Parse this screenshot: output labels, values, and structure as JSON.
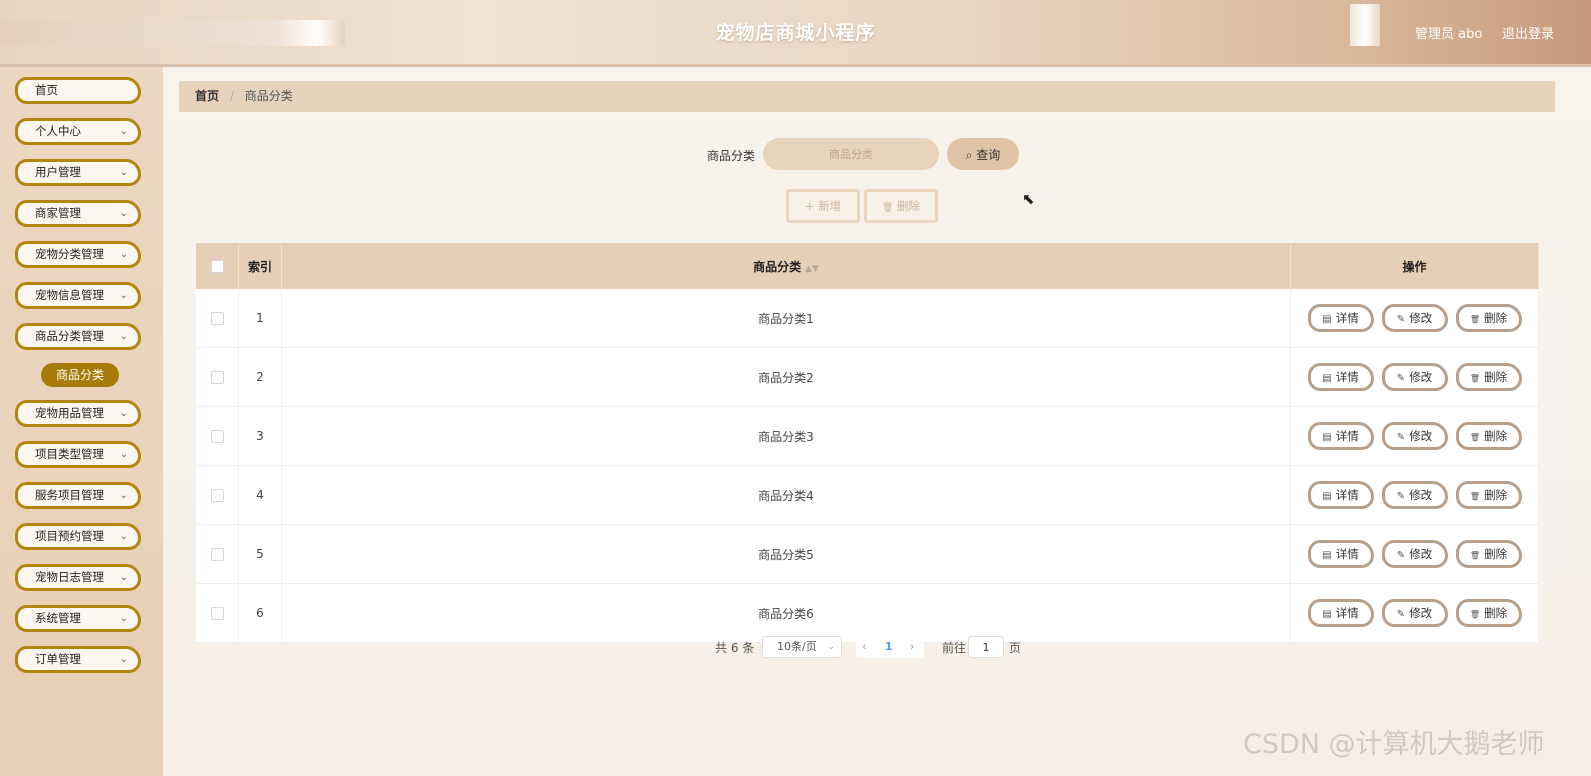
{
  "header": {
    "title": "宠物店商城小程序",
    "user_label": "管理员 abo",
    "logout_label": "退出登录"
  },
  "sidebar": {
    "items": [
      {
        "label": "首页",
        "has_arrow": false
      },
      {
        "label": "个人中心",
        "has_arrow": true
      },
      {
        "label": "用户管理",
        "has_arrow": true
      },
      {
        "label": "商家管理",
        "has_arrow": true
      },
      {
        "label": "宠物分类管理",
        "has_arrow": true
      },
      {
        "label": "宠物信息管理",
        "has_arrow": true
      },
      {
        "label": "商品分类管理",
        "has_arrow": true
      },
      {
        "label": "宠物用品管理",
        "has_arrow": true
      },
      {
        "label": "项目类型管理",
        "has_arrow": true
      },
      {
        "label": "服务项目管理",
        "has_arrow": true
      },
      {
        "label": "项目预约管理",
        "has_arrow": true
      },
      {
        "label": "宠物日志管理",
        "has_arrow": true
      },
      {
        "label": "系统管理",
        "has_arrow": true
      },
      {
        "label": "订单管理",
        "has_arrow": true
      }
    ],
    "active_sub": "商品分类"
  },
  "breadcrumb": {
    "home": "首页",
    "sep": "/",
    "current": "商品分类"
  },
  "search": {
    "label": "商品分类",
    "placeholder": "商品分类",
    "button": "查询"
  },
  "toolbar": {
    "add": "新增",
    "delete": "删除"
  },
  "table": {
    "headers": {
      "index": "索引",
      "category": "商品分类",
      "actions": "操作"
    },
    "rows": [
      {
        "index": "1",
        "category": "商品分类1"
      },
      {
        "index": "2",
        "category": "商品分类2"
      },
      {
        "index": "3",
        "category": "商品分类3"
      },
      {
        "index": "4",
        "category": "商品分类4"
      },
      {
        "index": "5",
        "category": "商品分类5"
      },
      {
        "index": "6",
        "category": "商品分类6"
      }
    ],
    "actions": {
      "detail": "详情",
      "edit": "修改",
      "delete": "删除"
    }
  },
  "pagination": {
    "total": "共 6 条",
    "page_size": "10条/页",
    "current": "1",
    "goto_label": "前往",
    "goto_value": "1",
    "unit": "页"
  },
  "watermark": "CSDN @计算机大鹅老师",
  "icons": {
    "search": "⌕",
    "plus": "+",
    "trash": "🗑",
    "detail": "▤",
    "edit": "✎",
    "chevron": "⌄"
  },
  "colors": {
    "accent": "#a77b08",
    "menu_border": "#b38610",
    "header_bg": "#e6cfb7"
  }
}
